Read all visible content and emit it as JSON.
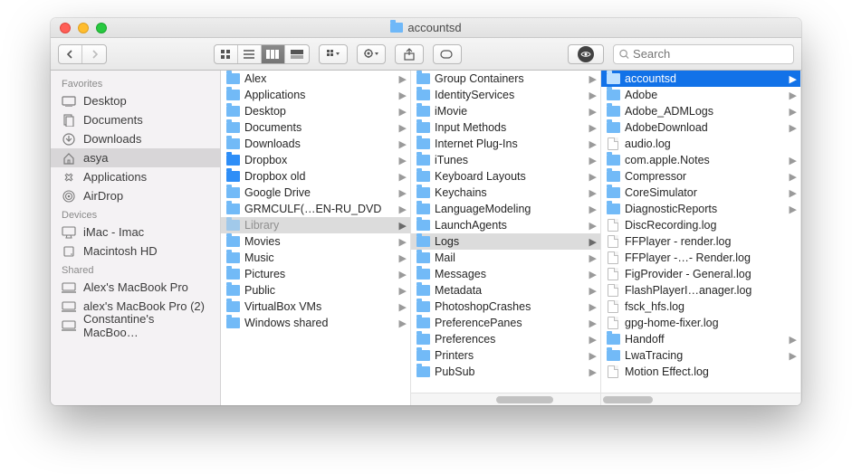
{
  "window": {
    "title": "accountsd"
  },
  "toolbar": {
    "search_placeholder": "Search"
  },
  "sidebar": {
    "sections": [
      {
        "header": "Favorites",
        "items": [
          {
            "icon": "desktop",
            "label": "Desktop"
          },
          {
            "icon": "documents",
            "label": "Documents"
          },
          {
            "icon": "downloads",
            "label": "Downloads"
          },
          {
            "icon": "home",
            "label": "asya",
            "selected": true
          },
          {
            "icon": "applications",
            "label": "Applications"
          },
          {
            "icon": "airdrop",
            "label": "AirDrop"
          }
        ]
      },
      {
        "header": "Devices",
        "items": [
          {
            "icon": "imac",
            "label": "iMac - Imac"
          },
          {
            "icon": "hdd",
            "label": "Macintosh HD"
          }
        ]
      },
      {
        "header": "Shared",
        "items": [
          {
            "icon": "remote",
            "label": "Alex's MacBook Pro"
          },
          {
            "icon": "remote",
            "label": "alex's MacBook Pro (2)"
          },
          {
            "icon": "remote",
            "label": "Constantine's MacBoo…"
          }
        ]
      }
    ]
  },
  "columns": [
    {
      "items": [
        {
          "type": "folder",
          "label": "Alex",
          "has_children": true
        },
        {
          "type": "folder",
          "label": "Applications",
          "has_children": true
        },
        {
          "type": "folder",
          "label": "Desktop",
          "has_children": true
        },
        {
          "type": "folder",
          "label": "Documents",
          "has_children": true
        },
        {
          "type": "folder",
          "label": "Downloads",
          "has_children": true
        },
        {
          "type": "dropbox",
          "label": "Dropbox",
          "has_children": true
        },
        {
          "type": "dropbox",
          "label": "Dropbox old",
          "has_children": true
        },
        {
          "type": "folder",
          "label": "Google Drive",
          "has_children": true
        },
        {
          "type": "folder",
          "label": "GRMCULF(…EN-RU_DVD",
          "has_children": true
        },
        {
          "type": "folder-dim",
          "label": "Library",
          "has_children": true,
          "selected": "gray"
        },
        {
          "type": "folder",
          "label": "Movies",
          "has_children": true
        },
        {
          "type": "folder",
          "label": "Music",
          "has_children": true
        },
        {
          "type": "folder",
          "label": "Pictures",
          "has_children": true
        },
        {
          "type": "folder",
          "label": "Public",
          "has_children": true
        },
        {
          "type": "folder",
          "label": "VirtualBox VMs",
          "has_children": true
        },
        {
          "type": "folder",
          "label": "Windows shared",
          "has_children": true
        }
      ]
    },
    {
      "items": [
        {
          "type": "folder",
          "label": "Group Containers",
          "has_children": true
        },
        {
          "type": "folder",
          "label": "IdentityServices",
          "has_children": true
        },
        {
          "type": "folder",
          "label": "iMovie",
          "has_children": true
        },
        {
          "type": "folder",
          "label": "Input Methods",
          "has_children": true
        },
        {
          "type": "folder",
          "label": "Internet Plug-Ins",
          "has_children": true
        },
        {
          "type": "folder",
          "label": "iTunes",
          "has_children": true
        },
        {
          "type": "folder",
          "label": "Keyboard Layouts",
          "has_children": true
        },
        {
          "type": "folder",
          "label": "Keychains",
          "has_children": true
        },
        {
          "type": "folder",
          "label": "LanguageModeling",
          "has_children": true
        },
        {
          "type": "folder",
          "label": "LaunchAgents",
          "has_children": true
        },
        {
          "type": "folder",
          "label": "Logs",
          "has_children": true,
          "selected": "gray"
        },
        {
          "type": "folder",
          "label": "Mail",
          "has_children": true
        },
        {
          "type": "folder",
          "label": "Messages",
          "has_children": true
        },
        {
          "type": "folder",
          "label": "Metadata",
          "has_children": true
        },
        {
          "type": "folder",
          "label": "PhotoshopCrashes",
          "has_children": true
        },
        {
          "type": "folder",
          "label": "PreferencePanes",
          "has_children": true
        },
        {
          "type": "folder",
          "label": "Preferences",
          "has_children": true
        },
        {
          "type": "folder",
          "label": "Printers",
          "has_children": true
        },
        {
          "type": "folder",
          "label": "PubSub",
          "has_children": true
        }
      ]
    },
    {
      "items": [
        {
          "type": "folder",
          "label": "accountsd",
          "has_children": true,
          "selected": "blue"
        },
        {
          "type": "folder",
          "label": "Adobe",
          "has_children": true
        },
        {
          "type": "folder",
          "label": "Adobe_ADMLogs",
          "has_children": true
        },
        {
          "type": "folder",
          "label": "AdobeDownload",
          "has_children": true
        },
        {
          "type": "file",
          "label": "audio.log"
        },
        {
          "type": "folder",
          "label": "com.apple.Notes",
          "has_children": true
        },
        {
          "type": "folder",
          "label": "Compressor",
          "has_children": true
        },
        {
          "type": "folder",
          "label": "CoreSimulator",
          "has_children": true
        },
        {
          "type": "folder",
          "label": "DiagnosticReports",
          "has_children": true
        },
        {
          "type": "file",
          "label": "DiscRecording.log"
        },
        {
          "type": "file",
          "label": "FFPlayer - render.log"
        },
        {
          "type": "file",
          "label": "FFPlayer -…- Render.log"
        },
        {
          "type": "file",
          "label": "FigProvider - General.log"
        },
        {
          "type": "file",
          "label": "FlashPlayerI…anager.log"
        },
        {
          "type": "file",
          "label": "fsck_hfs.log"
        },
        {
          "type": "file",
          "label": "gpg-home-fixer.log"
        },
        {
          "type": "folder",
          "label": "Handoff",
          "has_children": true
        },
        {
          "type": "folder",
          "label": "LwaTracing",
          "has_children": true
        },
        {
          "type": "file",
          "label": "Motion Effect.log"
        }
      ]
    }
  ]
}
